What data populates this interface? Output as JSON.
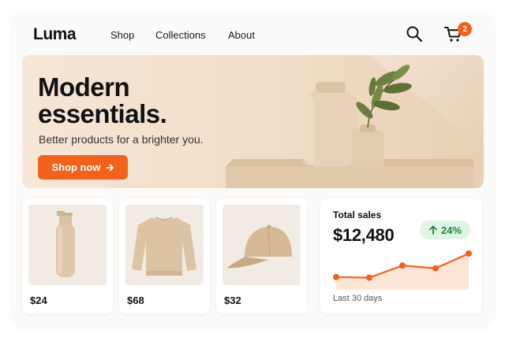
{
  "brand": {
    "name": "Luma",
    "accent": "#f2621c"
  },
  "nav": {
    "links": [
      "Shop",
      "Collections",
      "About"
    ],
    "cart_count": "2"
  },
  "icons": {
    "search": "search-icon",
    "cart": "shopping-cart-icon",
    "cta_arrow": "arrow-right-icon",
    "delta": "arrow-up-icon"
  },
  "hero": {
    "title": "Modern\nessentials.",
    "subtitle": "Better products for a brighter you.",
    "cta_label": "Shop now"
  },
  "products": [
    {
      "name": "bottle",
      "price": "$24"
    },
    {
      "name": "sweatshirt",
      "price": "$68"
    },
    {
      "name": "cap",
      "price": "$32"
    }
  ],
  "stats": {
    "label": "Total sales",
    "value": "$12,480",
    "delta": "24%",
    "period": "Last 30 days",
    "trend_relative": [
      0.12,
      0.1,
      0.55,
      0.45,
      1.0
    ]
  }
}
